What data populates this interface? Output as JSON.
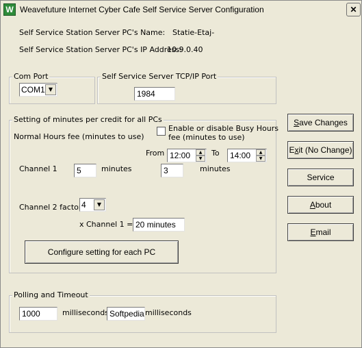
{
  "window": {
    "title": "Weavefuture Internet Cyber Cafe Self Service Server Configuration",
    "icon_letter": "W",
    "close_symbol": "✕"
  },
  "server_info": {
    "name_label": "Self Service Station Server PC's Name:",
    "name_value": "Statie-Etaj-",
    "ip_label": "Self Service Station Server PC's IP Address:",
    "ip_value": "10.9.0.40"
  },
  "com_port": {
    "group_title": "Com Port",
    "selected": "COM1"
  },
  "tcp_port": {
    "group_title": "Self Service Server TCP/IP Port",
    "value": "1984"
  },
  "minutes": {
    "group_title": "Setting of minutes per credit for all PCs",
    "normal_hours_label": "Normal Hours fee (minutes to use)",
    "busy_checkbox_label_line1": "Enable or disable Busy Hours",
    "busy_checkbox_label_line2": "fee (minutes to use)",
    "busy_checked": false,
    "from_label": "From",
    "from_value": "12:00",
    "to_label": "To",
    "to_value": "14:00",
    "channel1_label": "Channel  1",
    "channel1_value": "5",
    "channel1_unit": "minutes",
    "busy_value": "3",
    "busy_unit": "minutes",
    "channel2_label": "Channel  2 factor",
    "channel2_factor": "4",
    "channel2_formula_label": "x Channel 1 =",
    "channel2_result": "20 minutes",
    "configure_button": "Configure setting for each PC"
  },
  "polling": {
    "group_title": "Polling and Timeout",
    "polling_value": "1000",
    "polling_unit": "milliseconds",
    "timeout_value": "Softpedia",
    "timeout_unit": "milliseconds"
  },
  "buttons": {
    "save_mnemonic": "S",
    "save_rest": "ave Changes",
    "exit_pre": "E",
    "exit_mnemonic": "x",
    "exit_rest": "it (No Change)",
    "service": "Service",
    "about_mnemonic": "A",
    "about_rest": "bout",
    "email_mnemonic": "E",
    "email_rest": "mail"
  }
}
